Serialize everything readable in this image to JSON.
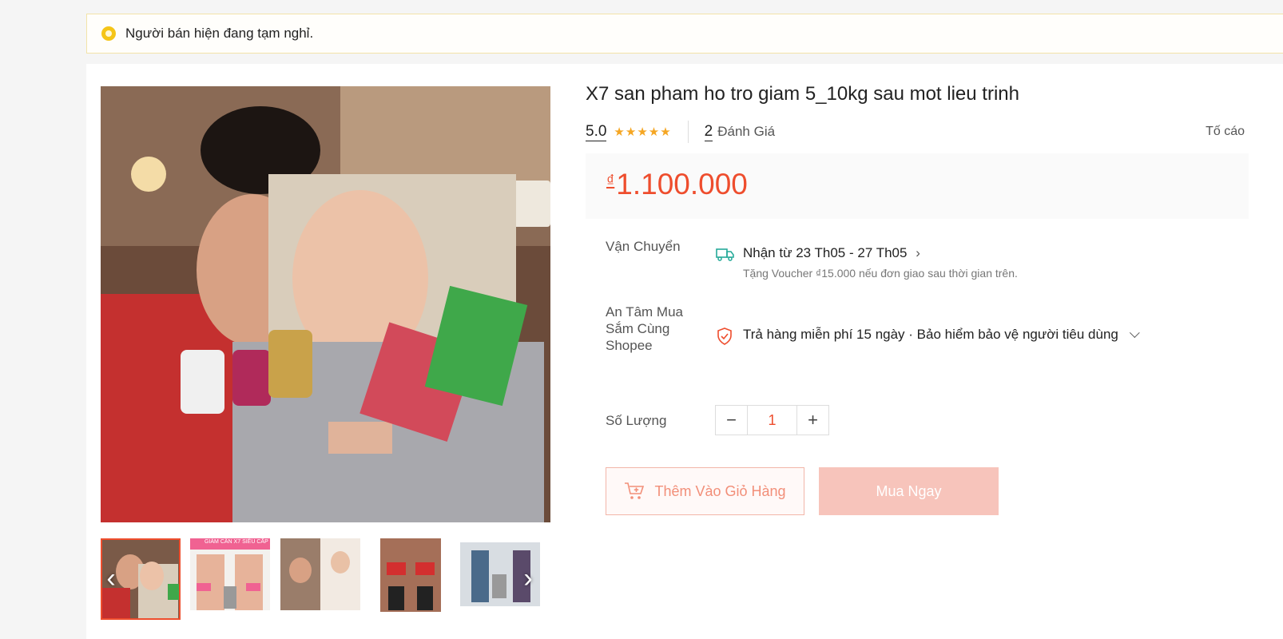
{
  "notice": {
    "text": "Người bán hiện đang tạm nghỉ."
  },
  "product": {
    "title": "X7 san pham ho tro giam 5_10kg sau mot lieu trinh",
    "rating": "5.0",
    "stars": "★★★★★",
    "review_count": "2",
    "review_label": "Đánh Giá",
    "report_label": "Tố cáo",
    "currency": "₫",
    "price": "1.100.000"
  },
  "shipping": {
    "label": "Vận Chuyển",
    "delivery": "Nhận từ 23 Th05 - 27 Th05",
    "voucher": "Tặng Voucher ₫15.000 nếu đơn giao sau thời gian trên."
  },
  "guarantee": {
    "label_lines": [
      "An Tâm Mua",
      "Sắm Cùng",
      "Shopee"
    ],
    "text": "Trả hàng miễn phí 15 ngày · Bảo hiểm bảo vệ người tiêu dùng"
  },
  "quantity": {
    "label": "Số Lượng",
    "value": "1",
    "minus": "−",
    "plus": "+"
  },
  "actions": {
    "add_to_cart": "Thêm Vào Giỏ Hàng",
    "buy_now": "Mua Ngay"
  },
  "gallery": {
    "prev_icon": "chevron-left-icon",
    "next_icon": "chevron-right-icon",
    "thumb_count": 5,
    "thumbs": [
      {
        "caption": ""
      },
      {
        "caption": "GIẢM CÂN X7 SIÊU CẤP"
      },
      {
        "caption": ""
      },
      {
        "caption": ""
      },
      {
        "caption": ""
      }
    ]
  },
  "colors": {
    "accent": "#ee4d2d",
    "star": "#f5a623",
    "buy_now_disabled": "#f7c4bb"
  }
}
